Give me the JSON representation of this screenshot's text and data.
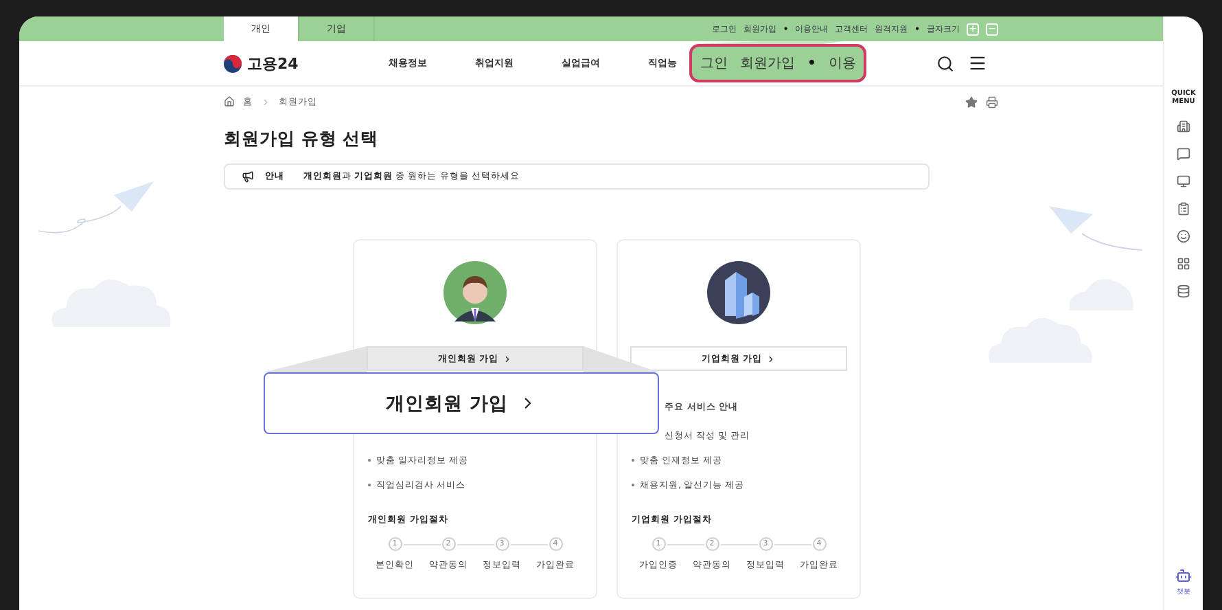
{
  "top_bar": {
    "tabs": [
      {
        "label": "개인",
        "selected": true
      },
      {
        "label": "기업",
        "selected": false
      }
    ],
    "links": [
      {
        "kind": "link",
        "label": "로그인"
      },
      {
        "kind": "link",
        "label": "회원가입"
      },
      {
        "kind": "separator",
        "label": "•"
      },
      {
        "kind": "link",
        "label": "이용안내"
      },
      {
        "kind": "link",
        "label": "고객센터"
      },
      {
        "kind": "link",
        "label": "원격지원"
      },
      {
        "kind": "separator",
        "label": "•"
      },
      {
        "kind": "link",
        "label": "글자크기"
      }
    ],
    "font_size_buttons": [
      "+",
      "−"
    ]
  },
  "header": {
    "logo": "고용24",
    "nav": [
      "채용정보",
      "취업지원",
      "실업급여",
      "직업능"
    ]
  },
  "header_magnifier": {
    "items": [
      {
        "kind": "link",
        "label": "그인"
      },
      {
        "kind": "link",
        "label": "회원가입"
      },
      {
        "kind": "separator",
        "label": "•"
      },
      {
        "kind": "link",
        "label": "이용"
      }
    ]
  },
  "breadcrumb": [
    "홈",
    "회원가입"
  ],
  "title": "회원가입 유형 선택",
  "notice": {
    "label": "안내",
    "text": "**개인회원**과 **기업회원** 중 원하는 유형을 선택하세요"
  },
  "cards": [
    {
      "kind": "person",
      "button": "개인회원 가입",
      "services": [
        "맞춤 일자리정보 제공",
        "직업심리검사 서비스"
      ],
      "procedure_title": "개인회원 가입절차",
      "steps": [
        {
          "number": "1",
          "label": "본인확인"
        },
        {
          "number": "2",
          "label": "약관동의"
        },
        {
          "number": "3",
          "label": "정보입력"
        },
        {
          "number": "4",
          "label": "가입완료"
        }
      ]
    },
    {
      "kind": "company",
      "button": "기업회원 가입",
      "services_heading": "주요 서비스 안내",
      "services": [
        "신청서 작성 및 관리",
        "맞춤 인재정보 제공",
        "채용지원, 알선기능 제공"
      ],
      "procedure_title": "기업회원 가입절차",
      "steps": [
        {
          "number": "1",
          "label": "가입인증"
        },
        {
          "number": "2",
          "label": "약관동의"
        },
        {
          "number": "3",
          "label": "정보입력"
        },
        {
          "number": "4",
          "label": "가입완료"
        }
      ]
    }
  ],
  "button_magnifier": {
    "label": "개인회원 가입"
  },
  "quick_menu": {
    "title": "QUICK MENU",
    "chatbot": "챗봇"
  }
}
